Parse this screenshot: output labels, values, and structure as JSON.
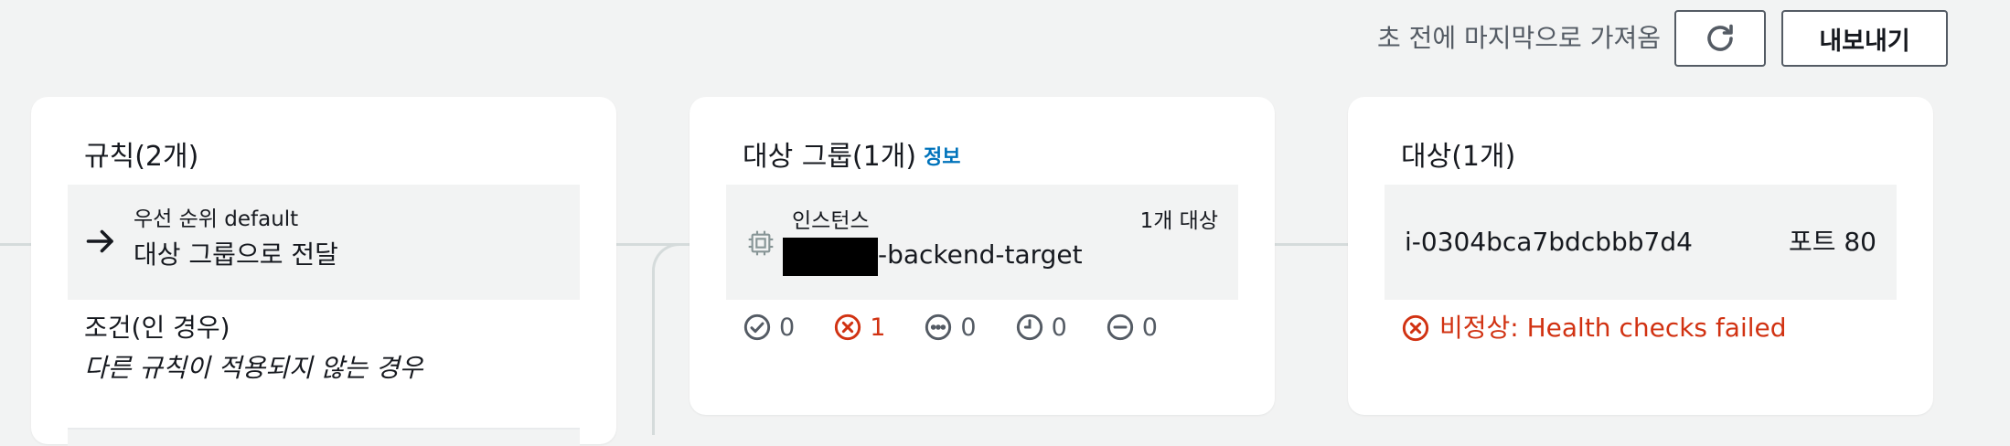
{
  "header": {
    "last_fetched": "초 전에 마지막으로 가져옴",
    "refresh_icon": "refresh-icon",
    "export_label": "내보내기"
  },
  "rules": {
    "title": "규칙(2개)",
    "priority": "우선 순위 default",
    "action": "대상 그룹으로 전달",
    "condition_label": "조건(인 경우)",
    "condition_value": "다른 규칙이 적용되지 않는 경우"
  },
  "target_groups": {
    "title": "대상 그룹(1개)",
    "info": "정보",
    "type": "인스턴스",
    "target_count": "1개 대상",
    "name": "-backend-target",
    "status_counts": [
      {
        "icon": "healthy-check-icon",
        "value": "0"
      },
      {
        "icon": "unhealthy-x-icon",
        "value": "1"
      },
      {
        "icon": "unused-ellipsis-icon",
        "value": "0"
      },
      {
        "icon": "pending-clock-icon",
        "value": "0"
      },
      {
        "icon": "draining-minus-icon",
        "value": "0"
      }
    ]
  },
  "targets": {
    "title": "대상(1개)",
    "instance_id": "i-0304bca7bdcbbb7d4",
    "port": "포트 80",
    "health": "비정상: Health checks failed"
  },
  "colors": {
    "background": "#f2f3f3",
    "error": "#d13212",
    "link": "#0073bb",
    "text": "#16191f",
    "muted": "#545b64"
  }
}
